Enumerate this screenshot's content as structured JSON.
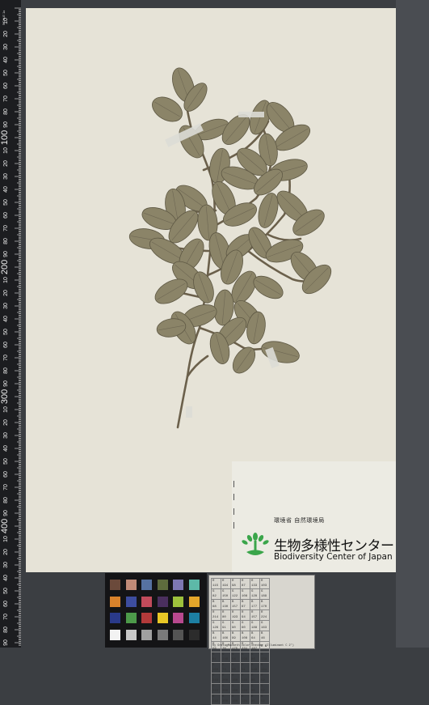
{
  "ruler": {
    "major_labels": [
      "10",
      "20",
      "30",
      "40",
      "50",
      "60",
      "70",
      "80",
      "90",
      "100",
      "10",
      "20",
      "30",
      "40",
      "50",
      "60",
      "70",
      "80",
      "90",
      "200",
      "10",
      "20",
      "30",
      "40",
      "50",
      "60",
      "70",
      "80",
      "90",
      "300",
      "10",
      "20",
      "30",
      "40",
      "50",
      "60",
      "70",
      "80",
      "90",
      "400",
      "10",
      "20",
      "30",
      "40",
      "50",
      "60",
      "70",
      "80",
      "90",
      "500"
    ],
    "large_labels": [
      "100",
      "200",
      "300",
      "400",
      "500"
    ],
    "corner_text": "SCALE 1x"
  },
  "label": {
    "agency_ja": "環境省 自然環境局",
    "center_name_ja": "生物多様性センター",
    "center_name_en": "Biodiversity Center of Japan"
  },
  "colors": {
    "sheet": "#e6e3d7",
    "leaf": "#8b8468",
    "stem": "#6b604b",
    "logo_green": "#3aa54a"
  },
  "color_target": {
    "patches": [
      [
        "#6b4a3b",
        "#c08a77",
        "#5672a1",
        "#5e6b3d",
        "#7d77b3",
        "#5db9a8"
      ],
      [
        "#d8822b",
        "#3d4d9e",
        "#c14b5b",
        "#4a2f5e",
        "#9dc13c",
        "#e3a62a"
      ],
      [
        "#2a3a8a",
        "#4d9a4a",
        "#b33a3a",
        "#e8c726",
        "#b8498f",
        "#1d7fa3"
      ],
      [
        "#f2f2f2",
        "#c8c8c8",
        "#a0a0a0",
        "#7a7a7a",
        "#545454",
        "#2c2c2c"
      ]
    ]
  },
  "rgb_card": {
    "rows": [
      [
        "R 115",
        "R 194",
        "R 98",
        "R 87",
        "R 133",
        "R 103"
      ],
      [
        "G 82",
        "G 150",
        "G 122",
        "G 108",
        "G 128",
        "G 189"
      ],
      [
        "B 68",
        "B 130",
        "B 157",
        "B 67",
        "B 177",
        "B 170"
      ],
      [
        "R 214",
        "R 80",
        "R 193",
        "R 94",
        "R 157",
        "R 224"
      ],
      [
        "G 126",
        "G 91",
        "G 90",
        "G 60",
        "G 188",
        "G 163"
      ],
      [
        "B 44",
        "B 166",
        "B 99",
        "B 108",
        "B 64",
        "B 46"
      ],
      [
        "R 56",
        "R 70",
        "R 175",
        "R 231",
        "R 187",
        "R 8"
      ],
      [
        "G 61",
        "G 148",
        "G 54",
        "G 199",
        "G 86",
        "G 133"
      ],
      [
        "B 150",
        "B 73",
        "B 60",
        "B 31",
        "B 149",
        "B 161"
      ],
      [
        "R 243",
        "R 200",
        "R 160",
        "R 122",
        "R 85",
        "R 52"
      ],
      [
        "G 243",
        "G 200",
        "G 160",
        "G 122",
        "G 85",
        "G 52"
      ],
      [
        "B 242",
        "B 200",
        "B 160",
        "B 121",
        "B 85",
        "B 52"
      ]
    ],
    "caption": "by GretagMacbeth color checker (Illuminant C 2°)"
  }
}
